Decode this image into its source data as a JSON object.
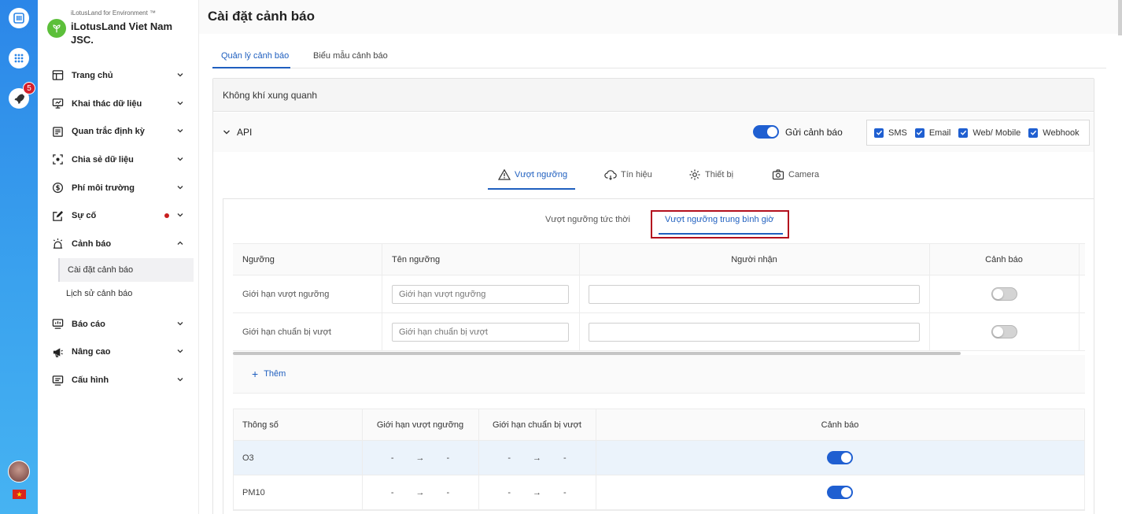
{
  "rail": {
    "notification_count": "5"
  },
  "brand": {
    "small_text": "iLotusLand for Environment ™",
    "name": "iLotusLand Viet Nam JSC."
  },
  "sidebar": {
    "items": [
      {
        "label": "Trang chủ",
        "icon": "layout-icon"
      },
      {
        "label": "Khai thác dữ liệu",
        "icon": "monitor-icon"
      },
      {
        "label": "Quan trắc định kỳ",
        "icon": "report-icon"
      },
      {
        "label": "Chia sẻ dữ liệu",
        "icon": "share-icon"
      },
      {
        "label": "Phí môi trường",
        "icon": "dollar-icon"
      },
      {
        "label": "Sự cố",
        "icon": "edit-icon"
      },
      {
        "label": "Cảnh báo",
        "icon": "alarm-icon"
      },
      {
        "label": "Báo cáo",
        "icon": "chart-icon"
      },
      {
        "label": "Nâng cao",
        "icon": "megaphone-icon"
      },
      {
        "label": "Cấu hình",
        "icon": "settings-screen-icon"
      }
    ],
    "subitems": [
      {
        "label": "Cài đặt cảnh báo",
        "active": true
      },
      {
        "label": "Lịch sử cảnh báo",
        "active": false
      }
    ]
  },
  "page": {
    "title": "Cài đặt cảnh báo",
    "tabs": [
      {
        "label": "Quản lý cảnh báo",
        "active": true
      },
      {
        "label": "Biểu mẫu cảnh báo",
        "active": false
      }
    ]
  },
  "panel": {
    "header": "Không khí xung quanh",
    "api_label": "API",
    "send_alert_label": "Gửi cảnh báo",
    "send_alert_on": true,
    "channels": [
      {
        "label": "SMS",
        "checked": true
      },
      {
        "label": "Email",
        "checked": true
      },
      {
        "label": "Web/ Mobile",
        "checked": true
      },
      {
        "label": "Webhook",
        "checked": true
      }
    ],
    "subtabs": [
      {
        "label": "Vượt ngưỡng",
        "icon": "warning-icon",
        "active": true
      },
      {
        "label": "Tín hiệu",
        "icon": "cloud-signal-icon",
        "active": false
      },
      {
        "label": "Thiết bị",
        "icon": "device-gear-icon",
        "active": false
      },
      {
        "label": "Camera",
        "icon": "camera-icon",
        "active": false
      }
    ],
    "modes": [
      {
        "label": "Vượt ngưỡng tức thời",
        "active": false
      },
      {
        "label": "Vượt ngưỡng trung bình giờ",
        "active": true
      }
    ]
  },
  "threshold_table": {
    "headers": [
      "Ngưỡng",
      "Tên ngưỡng",
      "Người nhận",
      "Cảnh báo"
    ],
    "rows": [
      {
        "name": "Giới hạn vượt ngưỡng",
        "placeholder": "Giới hạn vượt ngưỡng",
        "recipient": "",
        "alert_on": false
      },
      {
        "name": "Giới hạn chuẩn bị vượt",
        "placeholder": "Giới hạn chuẩn bị vượt",
        "recipient": "",
        "alert_on": false
      }
    ],
    "add_label": "Thêm"
  },
  "param_table": {
    "headers": [
      "Thông số",
      "Giới hạn vượt ngưỡng",
      "Giới hạn chuẩn bị vượt",
      "Cảnh báo"
    ],
    "rows": [
      {
        "param": "O3",
        "exceed_from": "-",
        "exceed_to": "-",
        "prepare_from": "-",
        "prepare_to": "-",
        "alert_on": true,
        "selected": true
      },
      {
        "param": "PM10",
        "exceed_from": "-",
        "exceed_to": "-",
        "prepare_from": "-",
        "prepare_to": "-",
        "alert_on": true,
        "selected": false
      }
    ]
  },
  "colors": {
    "accent": "#1f5fd1",
    "highlight_box": "#b30f1d",
    "rail_gradient_top": "#2b86e8"
  }
}
